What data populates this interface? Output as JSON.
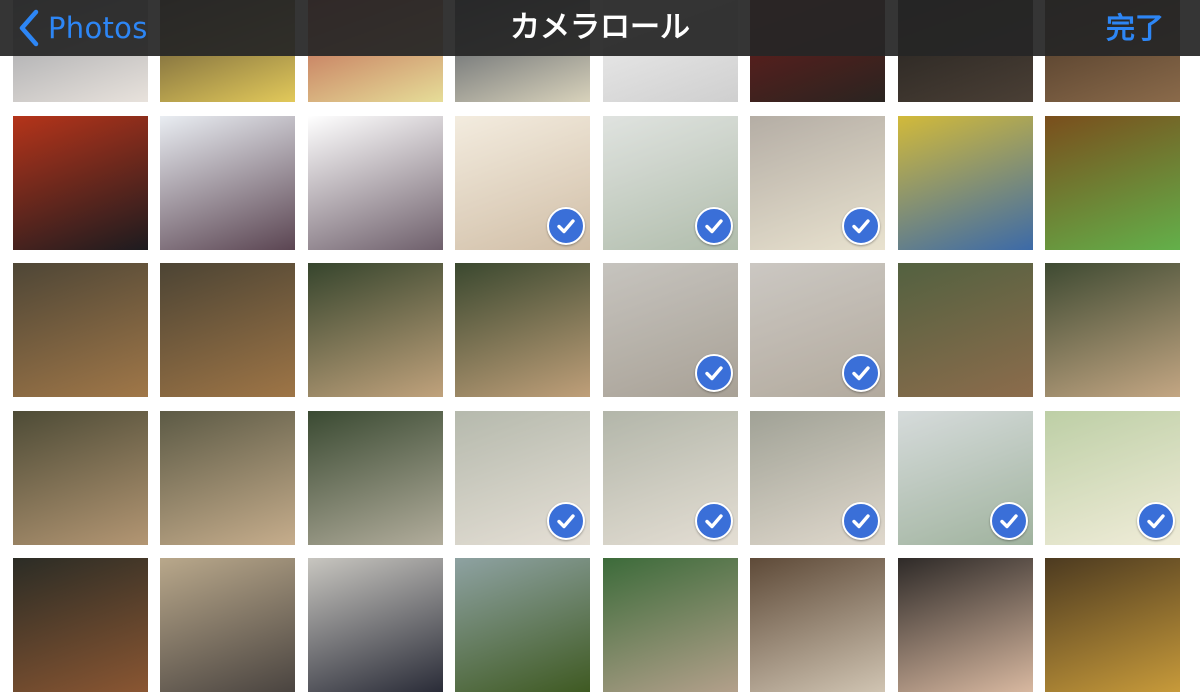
{
  "navbar": {
    "back_label": "Photos",
    "title": "カメラロール",
    "done_label": "完了"
  },
  "colors": {
    "accent": "#2d86f5",
    "check": "#3a6fd8",
    "navbar": "#262626"
  },
  "icons": {
    "back": "chevron-left-icon",
    "check": "checkmark-icon"
  },
  "photos": [
    [
      {
        "name": "baby-striped-blanket",
        "selected": false,
        "c1": "#8a8f97",
        "c2": "#e8e2dc"
      },
      {
        "name": "baby-yellow-shirt",
        "selected": false,
        "c1": "#3b2f2b",
        "c2": "#e2c95a"
      },
      {
        "name": "baby-striped-shirt",
        "selected": false,
        "c1": "#b23a3a",
        "c2": "#e6dd98"
      },
      {
        "name": "baby-sneakers",
        "selected": false,
        "c1": "#2a3448",
        "c2": "#d8d2bb"
      },
      {
        "name": "text-document",
        "selected": false,
        "c1": "#f7f7f7",
        "c2": "#cfcfcf"
      },
      {
        "name": "shrine-crowd",
        "selected": false,
        "c1": "#7a1a1a",
        "c2": "#2a2420"
      },
      {
        "name": "crowd-night",
        "selected": false,
        "c1": "#1a1a1a",
        "c2": "#4a3f35"
      },
      {
        "name": "child-in-crowd",
        "selected": false,
        "c1": "#3a2a1e",
        "c2": "#8a6a4a"
      }
    ],
    [
      {
        "name": "lantern-street",
        "selected": false,
        "c1": "#b5341a",
        "c2": "#1d1b1f"
      },
      {
        "name": "castle-plum-blossom",
        "selected": false,
        "c1": "#e9edf2",
        "c2": "#5b4552"
      },
      {
        "name": "castle-overexposed",
        "selected": false,
        "c1": "#ffffff",
        "c2": "#6e5f6b"
      },
      {
        "name": "clay-pot-spoon",
        "selected": true,
        "c1": "#ede2ce",
        "c2": "#b89c78"
      },
      {
        "name": "soup-dumplings",
        "selected": true,
        "c1": "#cfd4cf",
        "c2": "#879a80"
      },
      {
        "name": "dessert-glass",
        "selected": true,
        "c1": "#8d8275",
        "c2": "#ddd3b6"
      },
      {
        "name": "castle-mascot-sign",
        "selected": false,
        "c1": "#d2ba3a",
        "c2": "#3c6aa8"
      },
      {
        "name": "cake-dessert",
        "selected": false,
        "c1": "#7a4e1c",
        "c2": "#63b04a"
      }
    ],
    [
      {
        "name": "kid-capybara-1",
        "selected": false,
        "c1": "#4e4636",
        "c2": "#a07748"
      },
      {
        "name": "kid-capybara-2",
        "selected": false,
        "c1": "#4c4434",
        "c2": "#9e7546"
      },
      {
        "name": "kid-capybara-3",
        "selected": false,
        "c1": "#36452d",
        "c2": "#c0a27c"
      },
      {
        "name": "kid-capybara-4",
        "selected": false,
        "c1": "#3a482f",
        "c2": "#bf9f79"
      },
      {
        "name": "capybara-rocks",
        "selected": true,
        "c1": "#a8a49c",
        "c2": "#7a6f5e"
      },
      {
        "name": "capybara-closeup",
        "selected": true,
        "c1": "#b0aaa2",
        "c2": "#8a7d6a"
      },
      {
        "name": "kid-capybara-park",
        "selected": false,
        "c1": "#536140",
        "c2": "#8c6c4c"
      },
      {
        "name": "kid-capybara-5",
        "selected": false,
        "c1": "#3e4a32",
        "c2": "#c3a683"
      }
    ],
    [
      {
        "name": "kid-capybara-6",
        "selected": false,
        "c1": "#4d4b36",
        "c2": "#b39673"
      },
      {
        "name": "kid-capybaras",
        "selected": false,
        "c1": "#5c5a45",
        "c2": "#c6ad8c"
      },
      {
        "name": "kid-crouching-capybara",
        "selected": false,
        "c1": "#3a4a32",
        "c2": "#b2ad9c"
      },
      {
        "name": "capybara-resting-1",
        "selected": true,
        "c1": "#8e9481",
        "c2": "#d8cfc0"
      },
      {
        "name": "capybara-resting-2",
        "selected": true,
        "c1": "#8a8f7c",
        "c2": "#d6cdbd"
      },
      {
        "name": "capybara-resting-3",
        "selected": true,
        "c1": "#6e705e",
        "c2": "#cfc4b2"
      },
      {
        "name": "fence-enclosure",
        "selected": true,
        "c1": "#c0c8c8",
        "c2": "#6d8a6a"
      },
      {
        "name": "monkey-sign",
        "selected": true,
        "c1": "#9ab576",
        "c2": "#e9e3c5"
      }
    ],
    [
      {
        "name": "monkey-fence",
        "selected": false,
        "c1": "#2b2c25",
        "c2": "#8a5632"
      },
      {
        "name": "hippos",
        "selected": false,
        "c1": "#b9a88b",
        "c2": "#4a4440"
      },
      {
        "name": "kid-penguin",
        "selected": false,
        "c1": "#c8c6c0",
        "c2": "#2a2c38"
      },
      {
        "name": "kid-grass-field",
        "selected": false,
        "c1": "#8ea2a2",
        "c2": "#3f5a22"
      },
      {
        "name": "kid-goat",
        "selected": false,
        "c1": "#3c6b3a",
        "c2": "#b3a08b"
      },
      {
        "name": "family-path",
        "selected": false,
        "c1": "#5e4a38",
        "c2": "#d0c4b2"
      },
      {
        "name": "woman-monkey",
        "selected": false,
        "c1": "#2e2a28",
        "c2": "#d8b8a0"
      },
      {
        "name": "monkey-shoulder",
        "selected": false,
        "c1": "#4c3a20",
        "c2": "#c79a3a"
      }
    ]
  ]
}
